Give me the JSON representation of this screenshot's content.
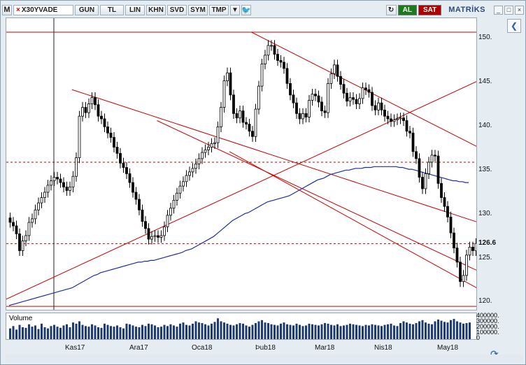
{
  "toolbar": {
    "m_label": "M",
    "symbol": "X30YVADE",
    "symbol_close": "×",
    "buttons": [
      "GUN",
      "TL",
      "LIN",
      "KHN",
      "SVD",
      "SYM",
      "TMP"
    ],
    "dropdown": "▼",
    "twitter": "🐦",
    "refresh": "↻",
    "refresh_color": "#2a8a2a",
    "al_label": "AL",
    "sat_label": "SAT",
    "brand": "MATRİKS",
    "window_buttons": [
      "_",
      "□",
      "×"
    ]
  },
  "axis": {
    "y_ticks": [
      "150.",
      "145.",
      "140.",
      "135.",
      "130.",
      "126.6",
      "125.",
      "120."
    ],
    "x_ticks": [
      "Kas17",
      "Ara17",
      "Oca18",
      "Þub18",
      "Mar18",
      "Nis18",
      "May18"
    ]
  },
  "volume": {
    "label": "Volume",
    "ticks": [
      "400000.",
      "300000.",
      "200000.",
      "100000.",
      "0"
    ]
  },
  "side": {
    "collapse_icon": "❮"
  },
  "sync_icon": "⟳",
  "chart_data": {
    "type": "candlestick",
    "ylim": [
      119.5,
      150.5
    ],
    "levels": {
      "resistance": 150.5,
      "dashed_upper": 135.8,
      "dashed_lower": 126.6,
      "support": 119.5
    },
    "colors": {
      "up": "#ffffff",
      "down": "#000000",
      "ma": "#1f2fa0",
      "channel": "#cc0000"
    },
    "close": [
      129.0,
      128.6,
      127.7,
      125.8,
      126.9,
      127.5,
      129.0,
      129.4,
      130.4,
      131.2,
      131.8,
      132.4,
      133.2,
      133.7,
      134.1,
      133.9,
      133.5,
      133.0,
      132.6,
      133.0,
      134.2,
      136.3,
      141.0,
      142.0,
      141.4,
      142.4,
      143.1,
      142.3,
      141.0,
      140.7,
      139.8,
      139.1,
      138.6,
      137.5,
      136.8,
      135.7,
      135.2,
      134.5,
      133.5,
      132.4,
      131.6,
      130.4,
      129.1,
      128.3,
      127.1,
      127.4,
      127.5,
      127.3,
      127.5,
      128.5,
      129.8,
      130.6,
      131.5,
      132.3,
      133.1,
      133.6,
      134.3,
      134.7,
      135.1,
      135.6,
      136.2,
      136.9,
      137.2,
      137.5,
      137.9,
      138.0,
      139.8,
      142.0,
      145.0,
      145.9,
      143.4,
      141.3,
      140.8,
      141.6,
      140.3,
      140.1,
      139.3,
      138.7,
      141.8,
      144.4,
      146.9,
      147.9,
      149.0,
      149.0,
      148.0,
      147.3,
      147.1,
      146.4,
      144.7,
      143.4,
      142.5,
      141.3,
      140.7,
      141.3,
      140.9,
      142.8,
      143.5,
      143.3,
      142.6,
      141.6,
      141.4,
      144.7,
      145.8,
      146.8,
      145.5,
      144.6,
      143.6,
      142.7,
      143.1,
      142.9,
      142.4,
      143.0,
      144.2,
      144.0,
      143.7,
      142.2,
      141.7,
      142.5,
      141.7,
      141.0,
      140.7,
      140.4,
      140.6,
      140.7,
      140.8,
      140.5,
      139.3,
      139.1,
      137.0,
      136.2,
      134.1,
      132.8,
      134.5,
      135.8,
      136.6,
      136.5,
      133.4,
      131.8,
      130.8,
      129.6,
      127.8,
      126.1,
      124.5,
      122.3,
      123.0,
      125.3,
      126.2,
      125.8,
      126.6
    ],
    "ma": [
      119.6,
      119.7,
      119.8,
      119.9,
      120.0,
      120.1,
      120.2,
      120.3,
      120.4,
      120.5,
      120.6,
      120.7,
      120.8,
      120.9,
      121.0,
      121.1,
      121.2,
      121.3,
      121.4,
      121.5,
      121.6,
      121.8,
      122.0,
      122.2,
      122.4,
      122.6,
      122.8,
      123.0,
      123.1,
      123.3,
      123.4,
      123.5,
      123.6,
      123.7,
      123.8,
      123.9,
      124.0,
      124.1,
      124.2,
      124.3,
      124.4,
      124.5,
      124.5,
      124.6,
      124.6,
      124.7,
      124.7,
      124.8,
      124.9,
      125.0,
      125.1,
      125.2,
      125.3,
      125.4,
      125.5,
      125.6,
      125.8,
      125.9,
      126.0,
      126.2,
      126.4,
      126.6,
      126.8,
      127.0,
      127.2,
      127.4,
      127.7,
      128.0,
      128.3,
      128.6,
      128.9,
      129.2,
      129.4,
      129.6,
      129.8,
      130.0,
      130.1,
      130.3,
      130.5,
      130.7,
      130.9,
      131.1,
      131.3,
      131.4,
      131.5,
      131.6,
      131.7,
      131.8,
      131.9,
      132.0,
      132.2,
      132.4,
      132.6,
      132.8,
      133.0,
      133.2,
      133.4,
      133.6,
      133.8,
      133.9,
      134.0,
      134.2,
      134.4,
      134.5,
      134.6,
      134.7,
      134.8,
      134.9,
      134.9,
      135.0,
      135.1,
      135.1,
      135.1,
      135.2,
      135.2,
      135.2,
      135.3,
      135.3,
      135.3,
      135.3,
      135.3,
      135.3,
      135.3,
      135.3,
      135.2,
      135.2,
      135.1,
      135.0,
      135.0,
      134.9,
      134.8,
      134.7,
      134.6,
      134.5,
      134.4,
      134.3,
      134.2,
      134.1,
      134.0,
      133.9,
      133.8,
      133.7,
      133.7,
      133.6,
      133.6,
      133.5,
      133.5
    ],
    "volume": [
      180000,
      220000,
      160000,
      240000,
      200000,
      190000,
      250000,
      210000,
      230000,
      170000,
      260000,
      200000,
      180000,
      220000,
      240000,
      210000,
      190000,
      230000,
      250000,
      200000,
      280000,
      260000,
      300000,
      240000,
      220000,
      210000,
      250000,
      230000,
      200000,
      190000,
      260000,
      240000,
      220000,
      210000,
      230000,
      200000,
      180000,
      260000,
      250000,
      230000,
      210000,
      200000,
      240000,
      220000,
      260000,
      250000,
      230000,
      200000,
      210000,
      240000,
      220000,
      250000,
      230000,
      210000,
      260000,
      280000,
      240000,
      230000,
      260000,
      300000,
      280000,
      270000,
      250000,
      230000,
      260000,
      290000,
      350000,
      300000,
      280000,
      260000,
      240000,
      230000,
      250000,
      270000,
      260000,
      230000,
      210000,
      240000,
      270000,
      300000,
      320000,
      280000,
      270000,
      250000,
      240000,
      230000,
      260000,
      280000,
      250000,
      240000,
      230000,
      260000,
      240000,
      220000,
      230000,
      260000,
      250000,
      240000,
      230000,
      250000,
      270000,
      260000,
      240000,
      230000,
      250000,
      220000,
      230000,
      240000,
      260000,
      250000,
      240000,
      230000,
      220000,
      240000,
      230000,
      250000,
      240000,
      230000,
      220000,
      240000,
      250000,
      260000,
      230000,
      220000,
      270000,
      300000,
      280000,
      260000,
      250000,
      270000,
      300000,
      320000,
      280000,
      260000,
      250000,
      300000,
      330000,
      310000,
      290000,
      280000,
      320000,
      340000,
      300000,
      280000,
      260000,
      270000,
      280000
    ],
    "x_labels": [
      "Kas17",
      "Ara17",
      "Oca18",
      "Þub18",
      "Mar18",
      "Nis18",
      "May18"
    ]
  }
}
